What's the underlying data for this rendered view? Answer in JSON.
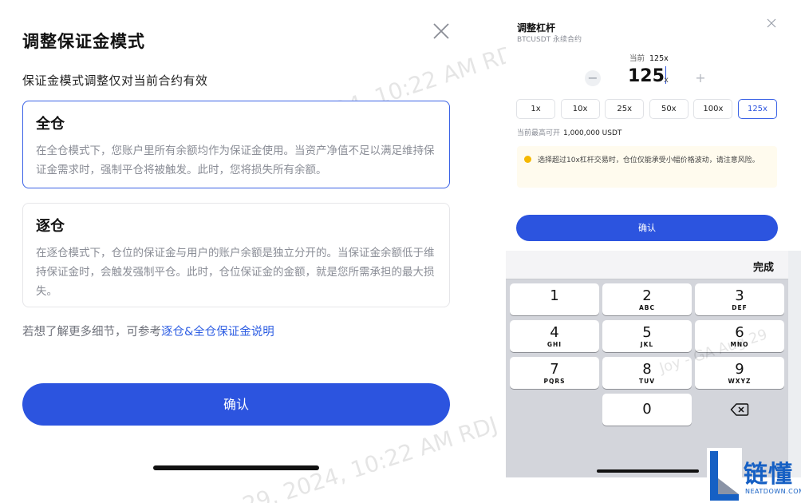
{
  "left_panel": {
    "title": "调整保证金模式",
    "subtitle": "保证金模式调整仅对当前合约有效",
    "cross": {
      "title": "全仓",
      "description": "在全仓模式下，您账户里所有余额均作为保证金使用。当资产净值不足以满足维持保证金需求时，强制平仓将被触发。此时，您将损失所有余额。"
    },
    "isolated": {
      "title": "逐仓",
      "description": "在逐仓模式下，仓位的保证金与用户的账户余额是独立分开的。当保证金余额低于维持保证金时，会触发强制平仓。此时，仓位保证金的金额，就是您所需承担的最大损失。"
    },
    "hint_prefix": "若想了解更多细节，可参考",
    "hint_link": "逐仓&全仓保证金说明",
    "confirm_label": "确认",
    "watermark_1": "GA Aug 29, 2024, 10:22 AM RDJ",
    "watermark_2": "29, 2024, 10:22 AM RDJ"
  },
  "right_panel": {
    "title": "调整杠杆",
    "subtitle": "BTCUSDT 永续合约",
    "current_label": "当前",
    "current_value": "125x",
    "leverage_value": "125",
    "leverage_unit": "x",
    "minus_symbol": "−",
    "plus_symbol": "+",
    "presets": [
      "1x",
      "10x",
      "25x",
      "50x",
      "100x",
      "125x"
    ],
    "active_preset": "125x",
    "max_label": "当前最高可开",
    "max_value": "1,000,000 USDT",
    "warning": "选择超过10x杠杆交易时，仓位仅能承受小幅价格波动，请注意风险。",
    "confirm_label": "确认",
    "watermark": "Joy - GA Aug 29"
  },
  "keyboard": {
    "done_label": "完成",
    "keys": [
      {
        "num": "1",
        "letters": ""
      },
      {
        "num": "2",
        "letters": "ABC"
      },
      {
        "num": "3",
        "letters": "DEF"
      },
      {
        "num": "4",
        "letters": "GHI"
      },
      {
        "num": "5",
        "letters": "JKL"
      },
      {
        "num": "6",
        "letters": "MNO"
      },
      {
        "num": "7",
        "letters": "PQRS"
      },
      {
        "num": "8",
        "letters": "TUV"
      },
      {
        "num": "9",
        "letters": "WXYZ"
      },
      {
        "num": "0",
        "letters": ""
      }
    ],
    "backspace_icon": "delete-left-icon"
  },
  "logo": {
    "name_cn": "链懂",
    "name_en": "NEATDOWN.COM"
  },
  "colors": {
    "accent": "#2c54df",
    "warning_dot": "#f5b800",
    "logo": "#1660c4"
  }
}
